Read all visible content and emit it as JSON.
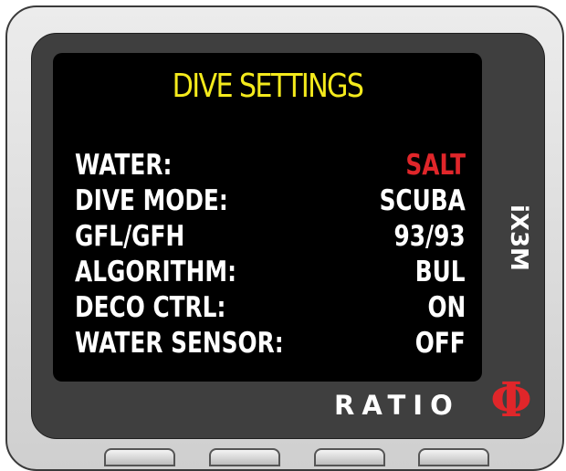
{
  "colors": {
    "title": "#f4ea1c",
    "value_alert": "#e0262a",
    "value_normal": "#ffffff",
    "brand_red": "#e0262a"
  },
  "screen": {
    "title": "DIVE SETTINGS",
    "rows": [
      {
        "label": "WATER:",
        "value": "SALT",
        "highlight": true
      },
      {
        "label": "DIVE MODE:",
        "value": "SCUBA",
        "highlight": false
      },
      {
        "label": "GFL/GFH",
        "value": "93/93",
        "highlight": false
      },
      {
        "label": "ALGORITHM:",
        "value": "BUL",
        "highlight": false
      },
      {
        "label": "DECO CTRL:",
        "value": "ON",
        "highlight": false
      },
      {
        "label": "WATER SENSOR:",
        "value": "OFF",
        "highlight": false
      }
    ]
  },
  "device": {
    "model": "iX3M",
    "brand": "RATIO",
    "brand_symbol": "Φ"
  },
  "buttons": [
    {
      "icon": "hardware-button"
    },
    {
      "icon": "hardware-button"
    },
    {
      "icon": "hardware-button"
    },
    {
      "icon": "hardware-button"
    }
  ]
}
